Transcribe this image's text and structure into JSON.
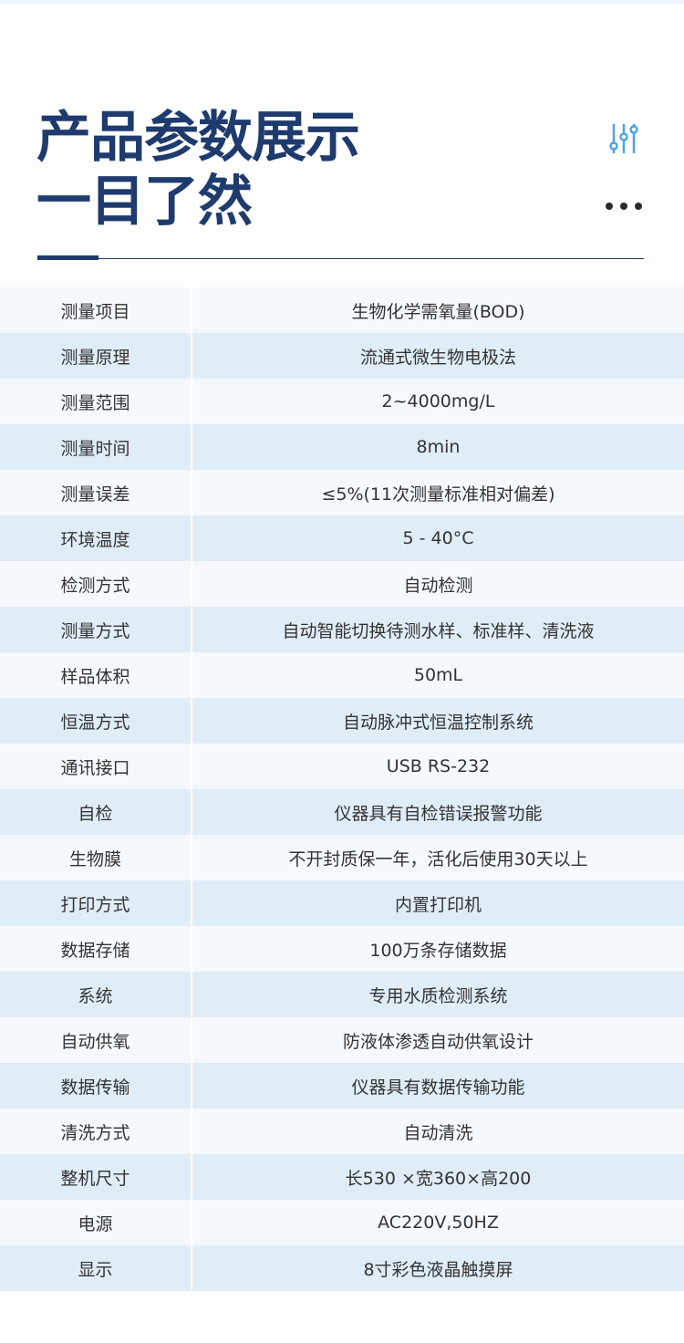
{
  "header": {
    "title_line1": "产品参数展示",
    "title_line2": "一目了然",
    "icons": [
      "sliders-icon",
      "more-dots-icon"
    ],
    "accent_color": "#1f3b6e",
    "icon_color": "#4aa3e8"
  },
  "specs": [
    {
      "label": "测量项目",
      "value": "生物化学需氧量(BOD)"
    },
    {
      "label": "测量原理",
      "value": "流通式微生物电极法"
    },
    {
      "label": "测量范围",
      "value": "2~4000mg/L"
    },
    {
      "label": "测量时间",
      "value": "8min"
    },
    {
      "label": "测量误差",
      "value": "≤5%(11次测量标准相对偏差)"
    },
    {
      "label": "环境温度",
      "value": "5 - 40°C"
    },
    {
      "label": "检测方式",
      "value": "自动检测"
    },
    {
      "label": "测量方式",
      "value": "自动智能切换待测水样、标准样、清洗液"
    },
    {
      "label": "样品体积",
      "value": "50mL"
    },
    {
      "label": "恒温方式",
      "value": "自动脉冲式恒温控制系统"
    },
    {
      "label": "通讯接口",
      "value": "USB RS-232"
    },
    {
      "label": "自检",
      "value": "仪器具有自检错误报警功能"
    },
    {
      "label": "生物膜",
      "value": "不开封质保一年，活化后使用30天以上"
    },
    {
      "label": "打印方式",
      "value": "内置打印机"
    },
    {
      "label": "数据存储",
      "value": "100万条存储数据"
    },
    {
      "label": "系统",
      "value": "专用水质检测系统"
    },
    {
      "label": "自动供氧",
      "value": "防液体渗透自动供氧设计"
    },
    {
      "label": "数据传输",
      "value": "仪器具有数据传输功能"
    },
    {
      "label": "清洗方式",
      "value": "自动清洗"
    },
    {
      "label": "整机尺寸",
      "value": "长530 ×宽360×高200"
    },
    {
      "label": "电源",
      "value": "AC220V,50HZ"
    },
    {
      "label": "显示",
      "value": "8寸彩色液晶触摸屏"
    }
  ]
}
